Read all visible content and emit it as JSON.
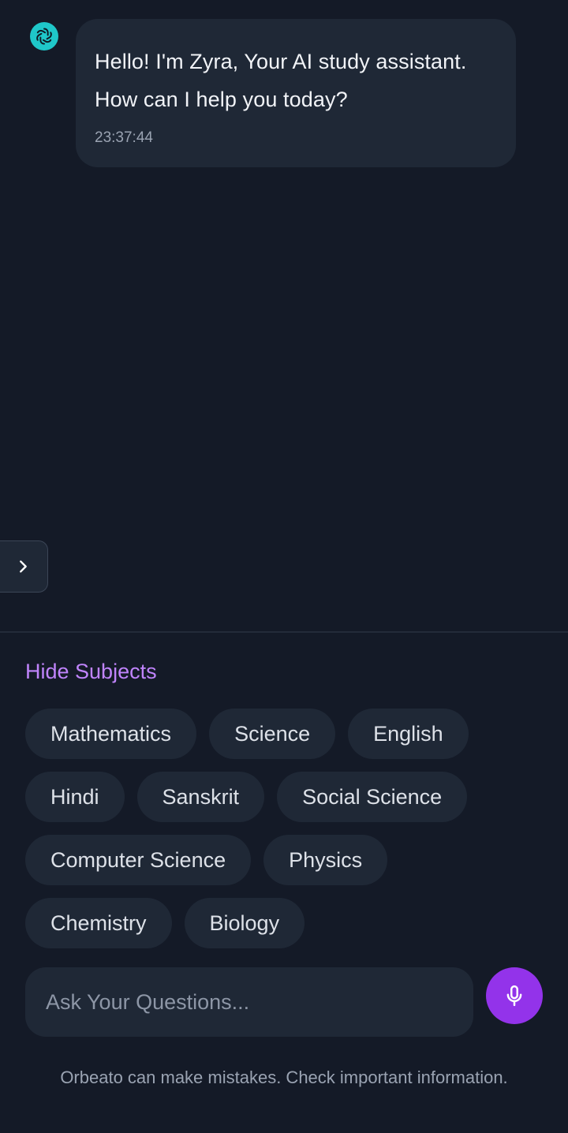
{
  "assistant": {
    "avatar_icon": "openai-knot-icon",
    "message": "Hello! I'm Zyra, Your AI study assistant. How can I help you today?",
    "timestamp": "23:37:44"
  },
  "sidebar_toggle": {
    "icon": "chevron-right-icon"
  },
  "subjects": {
    "toggle_label": "Hide Subjects",
    "items": [
      "Mathematics",
      "Science",
      "English",
      "Hindi",
      "Sanskrit",
      "Social Science",
      "Computer Science",
      "Physics",
      "Chemistry",
      "Biology"
    ]
  },
  "composer": {
    "placeholder": "Ask Your Questions...",
    "value": "",
    "mic_icon": "microphone-icon"
  },
  "disclaimer": "Orbeato can make mistakes. Check important information.",
  "colors": {
    "background": "#141a27",
    "surface": "#1f2836",
    "accent_purple": "#9333ea",
    "link_purple": "#c084fc",
    "avatar_teal": "#1fc7c9"
  }
}
